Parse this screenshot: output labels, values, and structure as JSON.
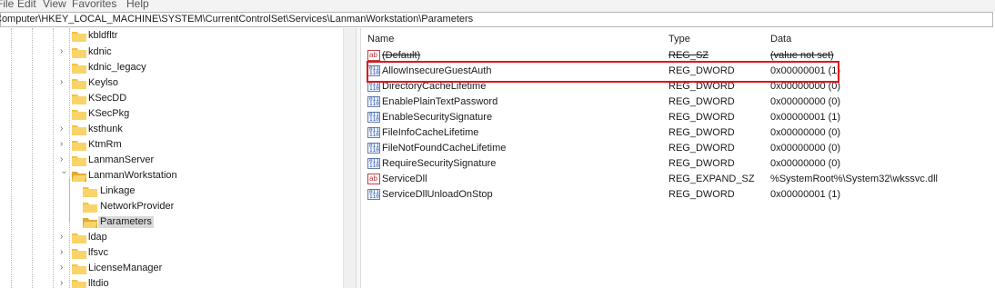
{
  "menu": [
    {
      "label": "File"
    },
    {
      "label": "Edit"
    },
    {
      "label": "View"
    },
    {
      "label": "Favorites"
    },
    {
      "label": "Help"
    }
  ],
  "address": "Computer\\HKEY_LOCAL_MACHINE\\SYSTEM\\CurrentControlSet\\Services\\LanmanWorkstation\\Parameters",
  "tree": [
    {
      "label": "kbldfltr"
    },
    {
      "label": "kdnic"
    },
    {
      "label": "kdnic_legacy"
    },
    {
      "label": "Keylso"
    },
    {
      "label": "KSecDD"
    },
    {
      "label": "KSecPkg"
    },
    {
      "label": "ksthunk"
    },
    {
      "label": "KtmRm"
    },
    {
      "label": "LanmanServer"
    },
    {
      "label": "LanmanWorkstation"
    },
    {
      "label": "Linkage"
    },
    {
      "label": "NetworkProvider"
    },
    {
      "label": "Parameters"
    },
    {
      "label": "ldap"
    },
    {
      "label": "lfsvc"
    },
    {
      "label": "LicenseManager"
    },
    {
      "label": "lltdio"
    }
  ],
  "columns": {
    "name": "Name",
    "type": "Type",
    "data": "Data"
  },
  "values": [
    {
      "icon": "string-value-icon",
      "name": "(Default)",
      "type": "REG_SZ",
      "data": "(value not set)"
    },
    {
      "icon": "binary-value-icon",
      "name": "AllowInsecureGuestAuth",
      "type": "REG_DWORD",
      "data": "0x00000001 (1)"
    },
    {
      "icon": "binary-value-icon",
      "name": "DirectoryCacheLifetime",
      "type": "REG_DWORD",
      "data": "0x00000000 (0)"
    },
    {
      "icon": "binary-value-icon",
      "name": "EnablePlainTextPassword",
      "type": "REG_DWORD",
      "data": "0x00000000 (0)"
    },
    {
      "icon": "binary-value-icon",
      "name": "EnableSecuritySignature",
      "type": "REG_DWORD",
      "data": "0x00000001 (1)"
    },
    {
      "icon": "binary-value-icon",
      "name": "FileInfoCacheLifetime",
      "type": "REG_DWORD",
      "data": "0x00000000 (0)"
    },
    {
      "icon": "binary-value-icon",
      "name": "FileNotFoundCacheLifetime",
      "type": "REG_DWORD",
      "data": "0x00000000 (0)"
    },
    {
      "icon": "binary-value-icon",
      "name": "RequireSecuritySignature",
      "type": "REG_DWORD",
      "data": "0x00000000 (0)"
    },
    {
      "icon": "string-value-icon",
      "name": "ServiceDll",
      "type": "REG_EXPAND_SZ",
      "data": "%SystemRoot%\\System32\\wkssvc.dll"
    },
    {
      "icon": "binary-value-icon",
      "name": "ServiceDllUnloadOnStop",
      "type": "REG_DWORD",
      "data": "0x00000001 (1)"
    }
  ],
  "colors": {
    "highlight_border": "#e0141b",
    "folder": "#f3c242",
    "selected": "#d9d9d9"
  }
}
